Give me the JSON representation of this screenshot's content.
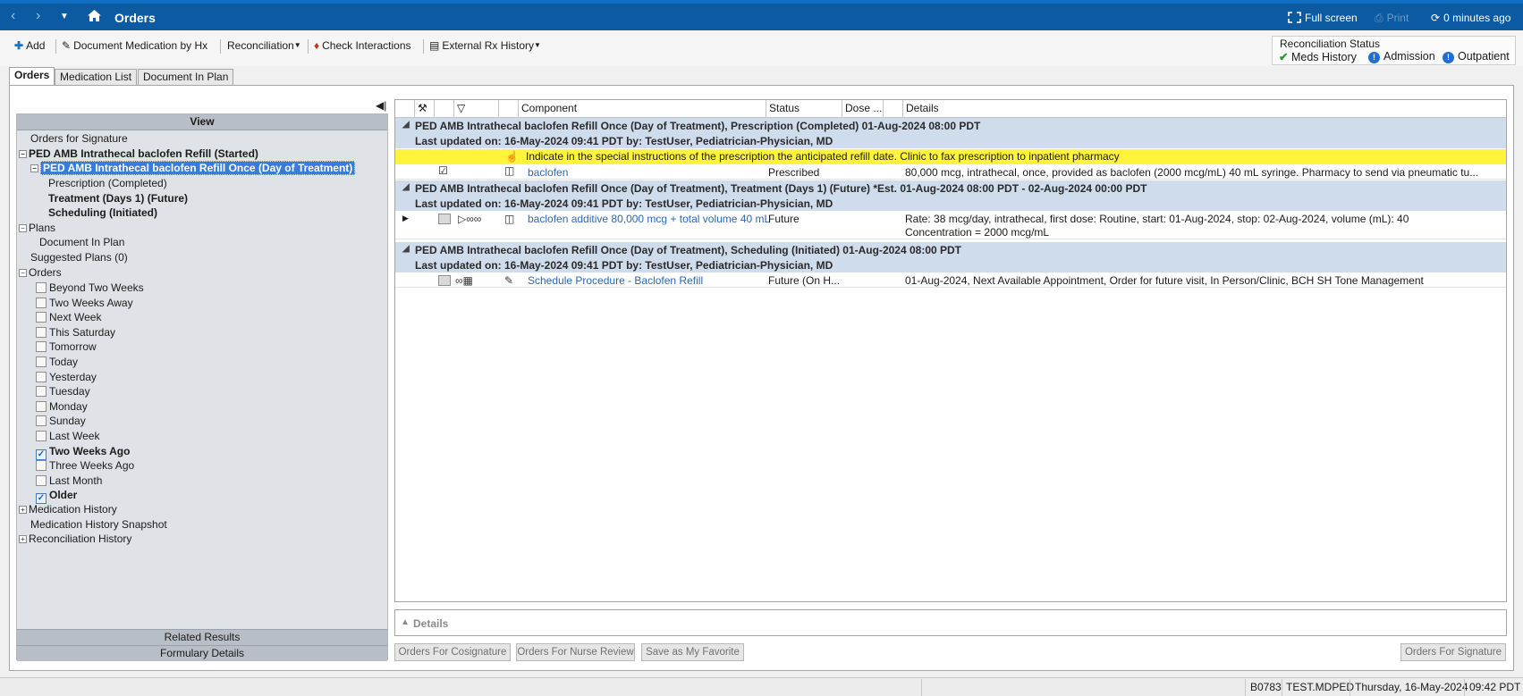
{
  "window": {
    "title": "Orders",
    "full_screen": "Full screen",
    "print": "Print",
    "refresh": "0 minutes ago"
  },
  "toolbar": {
    "add": "Add",
    "document_medication": "Document Medication by Hx",
    "reconciliation": "Reconciliation",
    "check_interactions": "Check Interactions",
    "external_rx": "External Rx History"
  },
  "reconciliation_status": {
    "title": "Reconciliation Status",
    "meds_history": "Meds History",
    "admission": "Admission",
    "outpatient": "Outpatient"
  },
  "tabs": [
    "Orders",
    "Medication List",
    "Document In Plan"
  ],
  "left_panel": {
    "header": "View",
    "orders_for_signature": "Orders for Signature",
    "plan_started": "PED AMB Intrathecal baclofen Refill (Started)",
    "plan_selected": "PED AMB Intrathecal baclofen Refill Once (Day of Treatment)",
    "phase_prescription": "Prescription (Completed)",
    "phase_treatment": "Treatment (Days 1) (Future)",
    "phase_scheduling": "Scheduling (Initiated)",
    "plans": "Plans",
    "document_in_plan": "Document In Plan",
    "suggested_plans": "Suggested Plans (0)",
    "orders": "Orders",
    "time_filters": [
      {
        "label": "Beyond Two Weeks",
        "checked": false
      },
      {
        "label": "Two Weeks Away",
        "checked": false
      },
      {
        "label": "Next Week",
        "checked": false
      },
      {
        "label": "This Saturday",
        "checked": false
      },
      {
        "label": "Tomorrow",
        "checked": false
      },
      {
        "label": "Today",
        "checked": false
      },
      {
        "label": "Yesterday",
        "checked": false
      },
      {
        "label": "Tuesday",
        "checked": false
      },
      {
        "label": "Monday",
        "checked": false
      },
      {
        "label": "Sunday",
        "checked": false
      },
      {
        "label": "Last Week",
        "checked": false
      },
      {
        "label": "Two Weeks Ago",
        "checked": true
      },
      {
        "label": "Three Weeks Ago",
        "checked": false
      },
      {
        "label": "Last Month",
        "checked": false
      },
      {
        "label": "Older",
        "checked": true
      }
    ],
    "medication_history": "Medication History",
    "medication_history_snapshot": "Medication History Snapshot",
    "reconciliation_history": "Reconciliation History",
    "related_results": "Related Results",
    "formulary_details": "Formulary Details"
  },
  "grid": {
    "columns": {
      "component": "Component",
      "status": "Status",
      "dose": "Dose ...",
      "details": "Details"
    },
    "phase1": {
      "title": "PED AMB Intrathecal baclofen Refill Once (Day of Treatment), Prescription (Completed) 01-Aug-2024 08:00 PDT",
      "updated": "Last updated on: 16-May-2024 09:41 PDT    by: TestUser, Pediatrician-Physician, MD",
      "note": "Indicate in the special instructions of the prescription the anticipated refill date. Clinic to fax prescription to inpatient pharmacy",
      "order": {
        "component": "baclofen",
        "status": "Prescribed",
        "details": "80,000 mcg, intrathecal, once, provided as baclofen (2000 mcg/mL) 40 mL syringe. Pharmacy to send via pneumatic tu..."
      }
    },
    "phase2": {
      "title": "PED AMB Intrathecal baclofen Refill Once (Day of Treatment), Treatment (Days 1) (Future) *Est. 01-Aug-2024 08:00 PDT - 02-Aug-2024 00:00 PDT",
      "updated": "Last updated on: 16-May-2024 09:41 PDT    by: TestUser, Pediatrician-Physician, MD",
      "order": {
        "component": "baclofen additive 80,000 mcg + total volume 40 mL",
        "status": "Future",
        "details_line1": "Rate: 38 mcg/day, intrathecal, first dose: Routine, start: 01-Aug-2024, stop: 02-Aug-2024, volume (mL): 40",
        "details_line2": "Concentration = 2000 mcg/mL"
      }
    },
    "phase3": {
      "title": "PED AMB Intrathecal baclofen Refill Once (Day of Treatment), Scheduling (Initiated) 01-Aug-2024 08:00 PDT",
      "updated": "Last updated on: 16-May-2024 09:41 PDT    by: TestUser, Pediatrician-Physician, MD",
      "order": {
        "component": "Schedule Procedure - Baclofen Refill",
        "status": "Future (On H...",
        "details": "01-Aug-2024, Next Available Appointment, Order for future visit, In Person/Clinic, BCH SH Tone Management"
      }
    }
  },
  "details_label": "Details",
  "buttons": {
    "cosignature": "Orders For Cosignature",
    "nurse_review": "Orders For Nurse Review",
    "favorite": "Save as My Favorite",
    "signature": "Orders For Signature"
  },
  "statusbar": {
    "code": "B0783",
    "user": "TEST.MDPED",
    "date": "Thursday, 16-May-2024",
    "time": "09:42 PDT"
  },
  "colors": {
    "titlebar": "#0b5aa2",
    "phase_header": "#cfdcec",
    "note_highlight": "#fff33c",
    "link": "#2d67b3",
    "selected": "#3a7ad8"
  }
}
